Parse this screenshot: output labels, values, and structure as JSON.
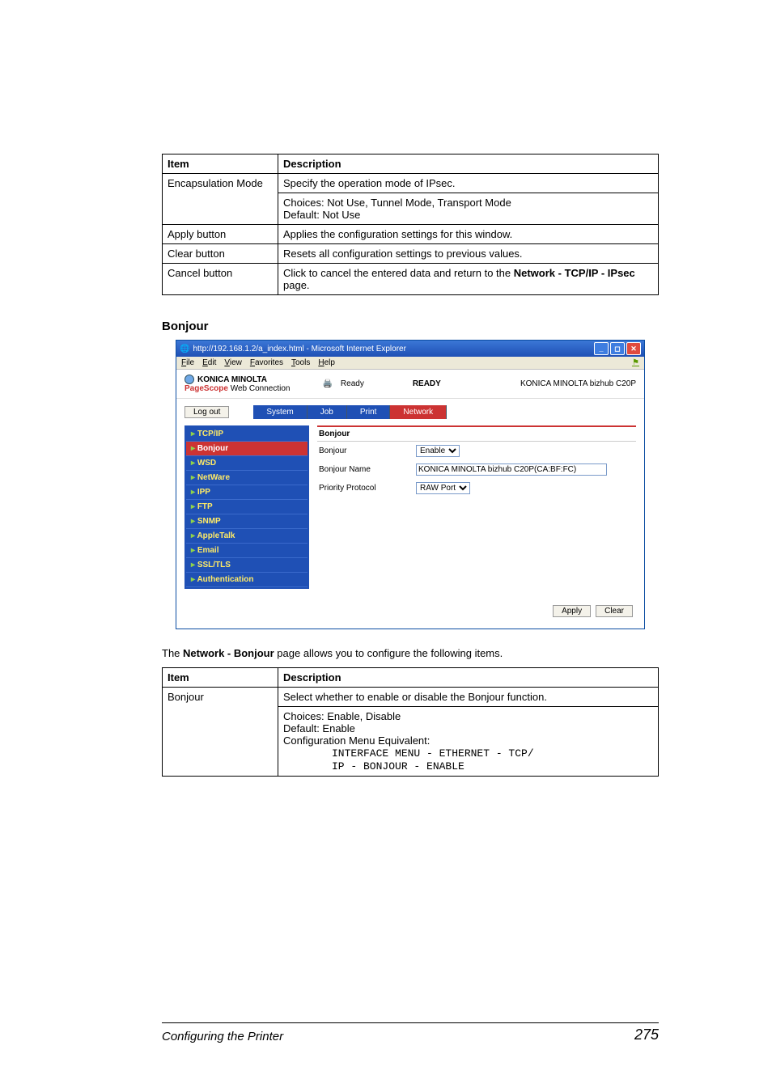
{
  "table1": {
    "headers": [
      "Item",
      "Description"
    ],
    "rows": [
      {
        "item": "Encapsulation Mode",
        "desc_lines": [
          "Specify the operation mode of IPsec.",
          "Choices: Not Use, Tunnel Mode, Transport Mode",
          "Default: Not Use"
        ]
      },
      {
        "item": "Apply button",
        "desc_lines": [
          "Applies the configuration settings for this window."
        ]
      },
      {
        "item": "Clear button",
        "desc_lines": [
          "Resets all configuration settings to previous values."
        ]
      },
      {
        "item": "Cancel button",
        "desc_lines": [
          "Click to cancel the entered data and return to the ",
          "<b>Network - TCP/IP - IPsec</b> page."
        ]
      }
    ]
  },
  "section_heading": "Bonjour",
  "screenshot": {
    "title": "http://192.168.1.2/a_index.html - Microsoft Internet Explorer",
    "menus": [
      "File",
      "Edit",
      "View",
      "Favorites",
      "Tools",
      "Help"
    ],
    "brand": "KONICA MINOLTA",
    "pagescope_prefix": "PageScope",
    "web_connection": " Web Connection",
    "status_label": "Ready",
    "ready_caps": "READY",
    "device": "KONICA MINOLTA bizhub C20P",
    "logout": "Log out",
    "tabs": [
      "System",
      "Job",
      "Print",
      "Network"
    ],
    "active_tab": 3,
    "sidebar": [
      "TCP/IP",
      "Bonjour",
      "WSD",
      "NetWare",
      "IPP",
      "FTP",
      "SNMP",
      "AppleTalk",
      "Email",
      "SSL/TLS",
      "Authentication"
    ],
    "sidebar_selected": 1,
    "main_title": "Bonjour",
    "fields": {
      "bonjour_label": "Bonjour",
      "bonjour_value": "Enable",
      "name_label": "Bonjour Name",
      "name_value": "KONICA MINOLTA bizhub C20P(CA:BF:FC)",
      "priority_label": "Priority Protocol",
      "priority_value": "RAW Port"
    },
    "apply": "Apply",
    "clear": "Clear"
  },
  "intro_prefix": "The ",
  "intro_bold": "Network - Bonjour",
  "intro_suffix": " page allows you to configure the following items.",
  "table2": {
    "headers": [
      "Item",
      "Description"
    ],
    "item": "Bonjour",
    "desc1": "Select whether to enable or disable the Bonjour function.",
    "choices": "Choices: Enable, Disable",
    "default": "Default:  Enable",
    "equiv": "Configuration Menu Equivalent:",
    "code1": "INTERFACE MENU - ETHERNET - TCP/",
    "code2": "IP - BONJOUR - ENABLE"
  },
  "footer": {
    "title": "Configuring the Printer",
    "page": "275"
  }
}
